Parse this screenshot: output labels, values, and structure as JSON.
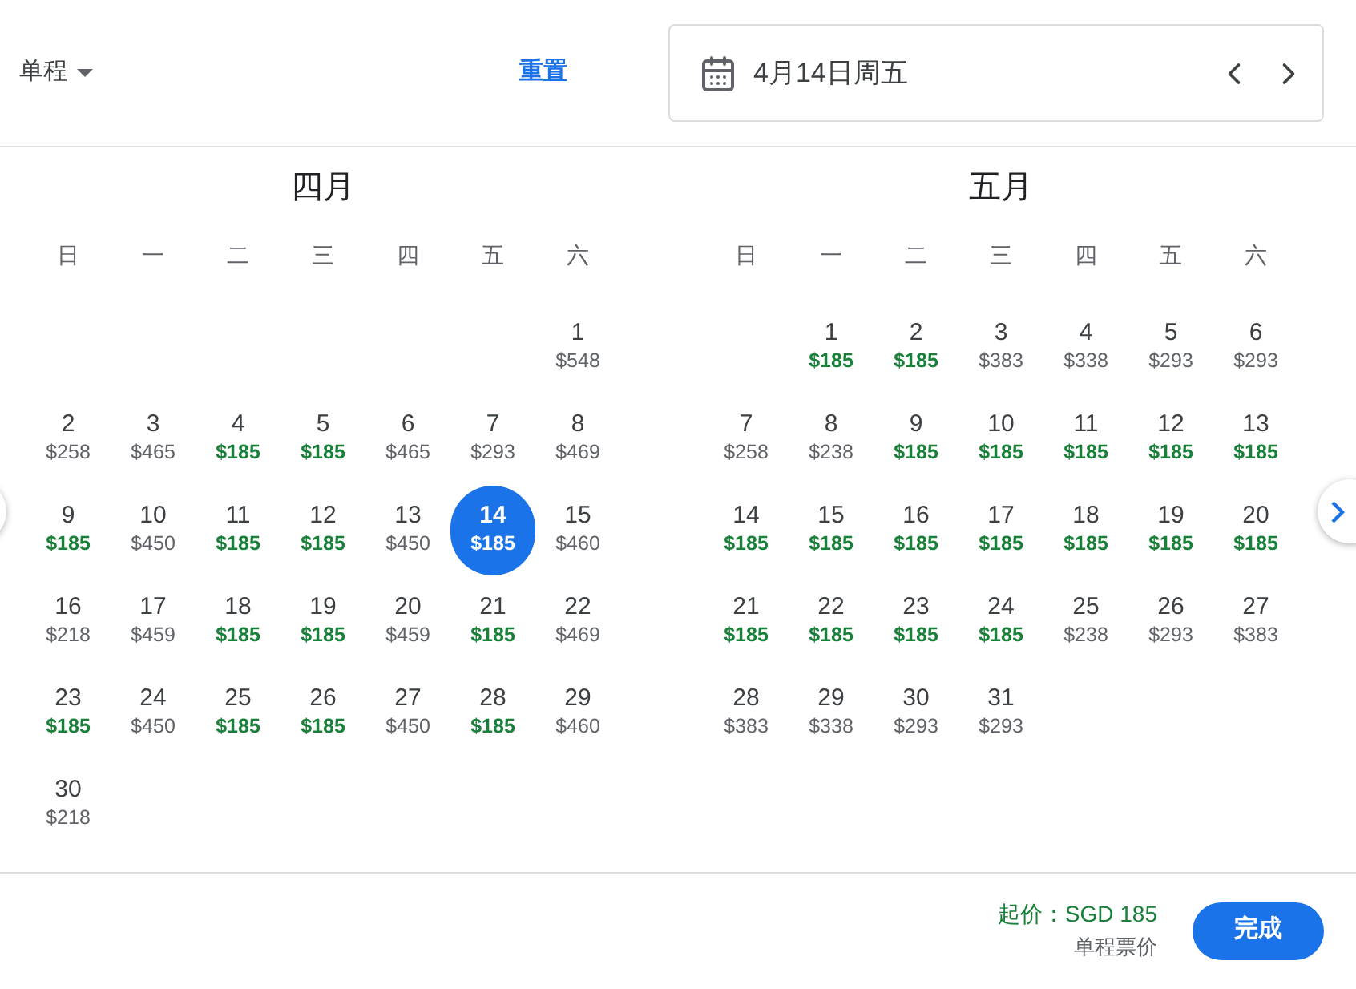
{
  "trip_type": {
    "label": "单程"
  },
  "reset": {
    "label": "重置"
  },
  "date_field": {
    "value": "4月14日周五"
  },
  "months": [
    {
      "title": "四月",
      "weekdays": [
        "日",
        "一",
        "二",
        "三",
        "四",
        "五",
        "六"
      ],
      "weeks": [
        [
          {
            "day": "1",
            "price": "$548",
            "cheap": false,
            "selected": false
          }
        ],
        [
          {
            "day": "2",
            "price": "$258",
            "cheap": false,
            "selected": false
          },
          {
            "day": "3",
            "price": "$465",
            "cheap": false,
            "selected": false
          },
          {
            "day": "4",
            "price": "$185",
            "cheap": true,
            "selected": false
          },
          {
            "day": "5",
            "price": "$185",
            "cheap": true,
            "selected": false
          },
          {
            "day": "6",
            "price": "$465",
            "cheap": false,
            "selected": false
          },
          {
            "day": "7",
            "price": "$293",
            "cheap": false,
            "selected": false
          },
          {
            "day": "8",
            "price": "$469",
            "cheap": false,
            "selected": false
          }
        ],
        [
          {
            "day": "9",
            "price": "$185",
            "cheap": true,
            "selected": false
          },
          {
            "day": "10",
            "price": "$450",
            "cheap": false,
            "selected": false
          },
          {
            "day": "11",
            "price": "$185",
            "cheap": true,
            "selected": false
          },
          {
            "day": "12",
            "price": "$185",
            "cheap": true,
            "selected": false
          },
          {
            "day": "13",
            "price": "$450",
            "cheap": false,
            "selected": false
          },
          {
            "day": "14",
            "price": "$185",
            "cheap": true,
            "selected": true
          },
          {
            "day": "15",
            "price": "$460",
            "cheap": false,
            "selected": false
          }
        ],
        [
          {
            "day": "16",
            "price": "$218",
            "cheap": false,
            "selected": false
          },
          {
            "day": "17",
            "price": "$459",
            "cheap": false,
            "selected": false
          },
          {
            "day": "18",
            "price": "$185",
            "cheap": true,
            "selected": false
          },
          {
            "day": "19",
            "price": "$185",
            "cheap": true,
            "selected": false
          },
          {
            "day": "20",
            "price": "$459",
            "cheap": false,
            "selected": false
          },
          {
            "day": "21",
            "price": "$185",
            "cheap": true,
            "selected": false
          },
          {
            "day": "22",
            "price": "$469",
            "cheap": false,
            "selected": false
          }
        ],
        [
          {
            "day": "23",
            "price": "$185",
            "cheap": true,
            "selected": false
          },
          {
            "day": "24",
            "price": "$450",
            "cheap": false,
            "selected": false
          },
          {
            "day": "25",
            "price": "$185",
            "cheap": true,
            "selected": false
          },
          {
            "day": "26",
            "price": "$185",
            "cheap": true,
            "selected": false
          },
          {
            "day": "27",
            "price": "$450",
            "cheap": false,
            "selected": false
          },
          {
            "day": "28",
            "price": "$185",
            "cheap": true,
            "selected": false
          },
          {
            "day": "29",
            "price": "$460",
            "cheap": false,
            "selected": false
          }
        ],
        [
          {
            "day": "30",
            "price": "$218",
            "cheap": false,
            "selected": false
          }
        ]
      ]
    },
    {
      "title": "五月",
      "weekdays": [
        "日",
        "一",
        "二",
        "三",
        "四",
        "五",
        "六"
      ],
      "weeks": [
        [
          {
            "day": "1",
            "price": "$185",
            "cheap": true,
            "selected": false
          },
          {
            "day": "2",
            "price": "$185",
            "cheap": true,
            "selected": false
          },
          {
            "day": "3",
            "price": "$383",
            "cheap": false,
            "selected": false
          },
          {
            "day": "4",
            "price": "$338",
            "cheap": false,
            "selected": false
          },
          {
            "day": "5",
            "price": "$293",
            "cheap": false,
            "selected": false
          },
          {
            "day": "6",
            "price": "$293",
            "cheap": false,
            "selected": false
          }
        ],
        [
          {
            "day": "7",
            "price": "$258",
            "cheap": false,
            "selected": false
          },
          {
            "day": "8",
            "price": "$238",
            "cheap": false,
            "selected": false
          },
          {
            "day": "9",
            "price": "$185",
            "cheap": true,
            "selected": false
          },
          {
            "day": "10",
            "price": "$185",
            "cheap": true,
            "selected": false
          },
          {
            "day": "11",
            "price": "$185",
            "cheap": true,
            "selected": false
          },
          {
            "day": "12",
            "price": "$185",
            "cheap": true,
            "selected": false
          },
          {
            "day": "13",
            "price": "$185",
            "cheap": true,
            "selected": false
          }
        ],
        [
          {
            "day": "14",
            "price": "$185",
            "cheap": true,
            "selected": false
          },
          {
            "day": "15",
            "price": "$185",
            "cheap": true,
            "selected": false
          },
          {
            "day": "16",
            "price": "$185",
            "cheap": true,
            "selected": false
          },
          {
            "day": "17",
            "price": "$185",
            "cheap": true,
            "selected": false
          },
          {
            "day": "18",
            "price": "$185",
            "cheap": true,
            "selected": false
          },
          {
            "day": "19",
            "price": "$185",
            "cheap": true,
            "selected": false
          },
          {
            "day": "20",
            "price": "$185",
            "cheap": true,
            "selected": false
          }
        ],
        [
          {
            "day": "21",
            "price": "$185",
            "cheap": true,
            "selected": false
          },
          {
            "day": "22",
            "price": "$185",
            "cheap": true,
            "selected": false
          },
          {
            "day": "23",
            "price": "$185",
            "cheap": true,
            "selected": false
          },
          {
            "day": "24",
            "price": "$185",
            "cheap": true,
            "selected": false
          },
          {
            "day": "25",
            "price": "$238",
            "cheap": false,
            "selected": false
          },
          {
            "day": "26",
            "price": "$293",
            "cheap": false,
            "selected": false
          },
          {
            "day": "27",
            "price": "$383",
            "cheap": false,
            "selected": false
          }
        ],
        [
          {
            "day": "28",
            "price": "$383",
            "cheap": false,
            "selected": false
          },
          {
            "day": "29",
            "price": "$338",
            "cheap": false,
            "selected": false
          },
          {
            "day": "30",
            "price": "$293",
            "cheap": false,
            "selected": false
          },
          {
            "day": "31",
            "price": "$293",
            "cheap": false,
            "selected": false
          }
        ]
      ]
    }
  ],
  "footer": {
    "price": "起价：SGD 185",
    "note": "单程票价",
    "done_button": "完成"
  }
}
